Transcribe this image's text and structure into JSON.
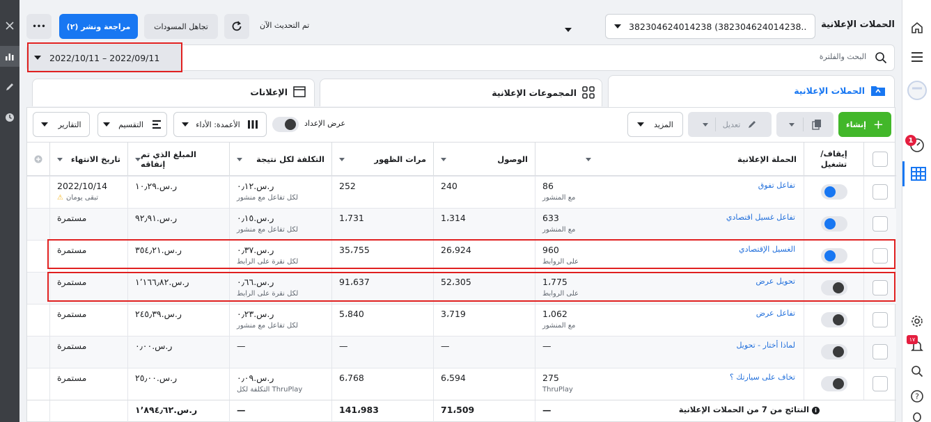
{
  "header": {
    "title": "الحملات الإعلانية",
    "account_selector": "382304624014238 (382304624014238...",
    "updated_text": "تم التحديث الآن",
    "discard_drafts": "تجاهل المسودات",
    "review_publish": "مراجعة ونشر (٢)",
    "more_dots": "•••"
  },
  "search": {
    "placeholder": "البحث والفلترة",
    "date_range": "2022/10/11 – 2022/09/11"
  },
  "tabs": [
    {
      "label": "الحملات الإعلانية",
      "active": true
    },
    {
      "label": "المجموعات الإعلانية",
      "active": false
    },
    {
      "label": "الإعلانات",
      "active": false
    }
  ],
  "toolbar": {
    "create": "إنشاء",
    "edit": "تعديل",
    "more": "المزيد",
    "view_setup": "عرض الإعداد",
    "columns": "الأعمدة: الأداء",
    "breakdown": "التقسيم",
    "reports": "التقارير"
  },
  "table": {
    "columns": {
      "toggle": "إيقاف/ تشغيل",
      "campaign": "الحملة الإعلانية",
      "results": "",
      "reach": "الوصول",
      "impressions": "مرات الظهور",
      "cost": "التكلفة لكل نتيجة",
      "spent": "المبلغ الذي تم إنفاقه",
      "end": "تاريخ الانتهاء"
    },
    "rows": [
      {
        "name": "تفاعل تفوق",
        "on": true,
        "results": "86",
        "results_sub": "مع المنشور",
        "reach": "240",
        "impressions": "252",
        "cost": "ر.س.٠٫١٢",
        "cost_sub": "لكل تفاعل مع منشور",
        "spent": "ر.س.١٠٫٢٩",
        "end": "2022/10/14",
        "end_sub": "تبقى يومان"
      },
      {
        "name": "تفاعل غسيل اقتصادي",
        "on": true,
        "results": "633",
        "results_sub": "مع المنشور",
        "reach": "1،314",
        "impressions": "1،731",
        "cost": "ر.س.٠٫١٥",
        "cost_sub": "لكل تفاعل مع منشور",
        "spent": "ر.س.٩٢٫٩١",
        "end": "مستمرة",
        "end_sub": ""
      },
      {
        "name": "الغسيل الإقتصادي",
        "on": true,
        "results": "960",
        "results_sub": "على الروابط",
        "reach": "26،924",
        "impressions": "35،755",
        "cost": "ر.س.٠٫٣٧",
        "cost_sub": "لكل نقرة على الرابط",
        "spent": "ر.س.٣٥٤٫٢١",
        "end": "مستمرة",
        "end_sub": ""
      },
      {
        "name": "تحويل عرض",
        "on": false,
        "results": "1،775",
        "results_sub": "على الروابط",
        "reach": "52،305",
        "impressions": "91،637",
        "cost": "ر.س.٠٫٦٦",
        "cost_sub": "لكل نقرة على الرابط",
        "spent": "ر.س.١٬١٦٦٫٨٢",
        "end": "مستمرة",
        "end_sub": ""
      },
      {
        "name": "تفاعل عرض",
        "on": false,
        "results": "1،062",
        "results_sub": "مع المنشور",
        "reach": "3،719",
        "impressions": "5،840",
        "cost": "ر.س.٠٫٢٣",
        "cost_sub": "لكل تفاعل مع منشور",
        "spent": "ر.س.٢٤٥٫٣٩",
        "end": "مستمرة",
        "end_sub": ""
      },
      {
        "name": "لماذا أختار - تحويل",
        "on": false,
        "results": "—",
        "results_sub": "",
        "reach": "—",
        "impressions": "—",
        "cost": "—",
        "cost_sub": "",
        "spent": "ر.س.٠٫٠٠",
        "end": "مستمرة",
        "end_sub": ""
      },
      {
        "name": "تخاف على سيارتك ؟",
        "on": false,
        "results": "275",
        "results_sub": "ThruPlay",
        "reach": "6،594",
        "impressions": "6،768",
        "cost": "ر.س.٠٫٠٩",
        "cost_sub": "التكلفة لكل ThruPlay",
        "spent": "ر.س.٢٥٫٠٠",
        "end": "مستمرة",
        "end_sub": ""
      }
    ],
    "totals": {
      "label": "النتائج من 7 من الحملات الإعلانية",
      "results": "—",
      "reach": "71،509",
      "impressions": "141،983",
      "cost": "—",
      "spent": "ر.س.١٬٨٩٤٫٦٢"
    }
  },
  "notifications": {
    "badge_profile": "1",
    "badge_bell": "١٧"
  },
  "colors": {
    "accent": "#1877f2",
    "create": "#42b72a",
    "highlight": "#e02020"
  }
}
